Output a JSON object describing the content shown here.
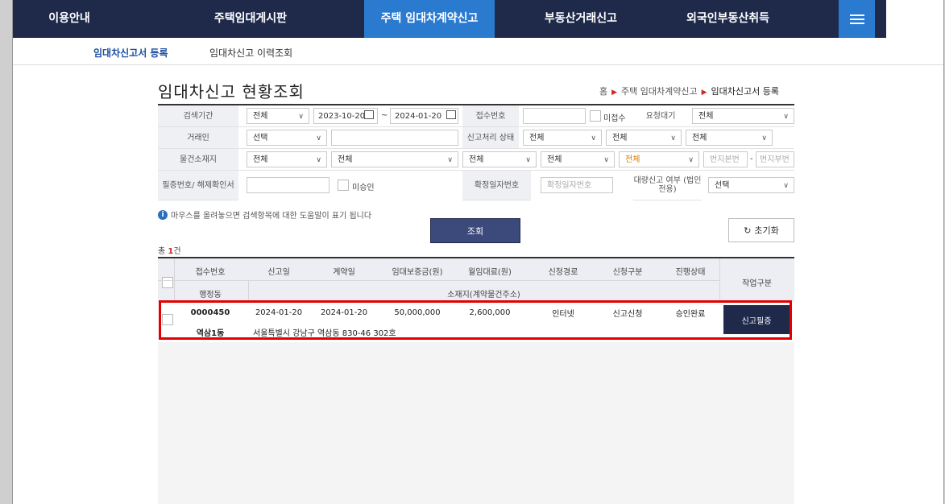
{
  "topnav": {
    "items": [
      "이용안내",
      "주택임대게시판",
      "주택 임대차계약신고",
      "부동산거래신고",
      "외국인부동산취득"
    ],
    "active_index": 2,
    "menu_icon": "hamburger-icon"
  },
  "subnav": {
    "items": [
      "임대차신고서 등록",
      "임대차신고 이력조회"
    ]
  },
  "page": {
    "title": "임대차신고 현황조회",
    "breadcrumb": [
      "홈",
      "주택 임대차계약신고",
      "임대차신고서 등록"
    ]
  },
  "search": {
    "period_label": "검색기간",
    "period_select": "전체",
    "date_from": "2023-10-20",
    "date_to": "2024-01-20",
    "date_sep": "~",
    "receipt_no_label": "접수번호",
    "receipt_no_value": "",
    "unreceived_label": "미접수",
    "request_wait_label": "요청대기",
    "request_wait_select": "전체",
    "party_label": "거래인",
    "party_select": "선택",
    "party_input": "",
    "status_label": "신고처리 상태",
    "status_select1": "전체",
    "status_select2": "전체",
    "status_select3": "전체",
    "location_label": "물건소재지",
    "loc_sido": "전체",
    "loc_sigungu": "전체",
    "loc_dong": "전체",
    "loc_ri": "전체",
    "loc_type": "전체",
    "bunji_main_placeholder": "번지본번",
    "bunji_dash": "-",
    "bunji_sub_placeholder": "번지부번",
    "cert_label": "필증번호/ 해제확인서",
    "cert_value": "",
    "unapproved_label": "미승인",
    "fixed_date_label": "확정일자번호",
    "fixed_date_placeholder": "확정일자번호",
    "bulk_label": "대량신고 여부 (법인전용)",
    "bulk_select": "선택"
  },
  "info_text": "마우스를 올려놓으면 검색항목에 대한 도움말이 표기 됩니다",
  "buttons": {
    "search": "조회",
    "reset": "초기화"
  },
  "total": {
    "prefix": "총 ",
    "count": "1",
    "suffix": "건"
  },
  "table": {
    "headers_top": [
      "접수번호",
      "신고일",
      "계약일",
      "임대보증금(원)",
      "월임대료(원)",
      "신청경로",
      "신청구분",
      "진행상태"
    ],
    "header_dong": "행정동",
    "header_address": "소재지(계약물건주소)",
    "header_action": "작업구분",
    "rows": [
      {
        "receipt_no": "0000450",
        "report_date": "2024-01-20",
        "contract_date": "2024-01-20",
        "deposit": "50,000,000",
        "monthly_rent": "2,600,000",
        "channel": "인터넷",
        "type": "신고신청",
        "status": "승인완료",
        "dong": "역삼1동",
        "address": "서울특별시 강남구 역삼동 830-46 302호",
        "action": "신고필증"
      }
    ]
  },
  "colors": {
    "nav_bg": "#1f2a4b",
    "nav_active": "#2a7ad0",
    "highlight": "#e30000"
  }
}
